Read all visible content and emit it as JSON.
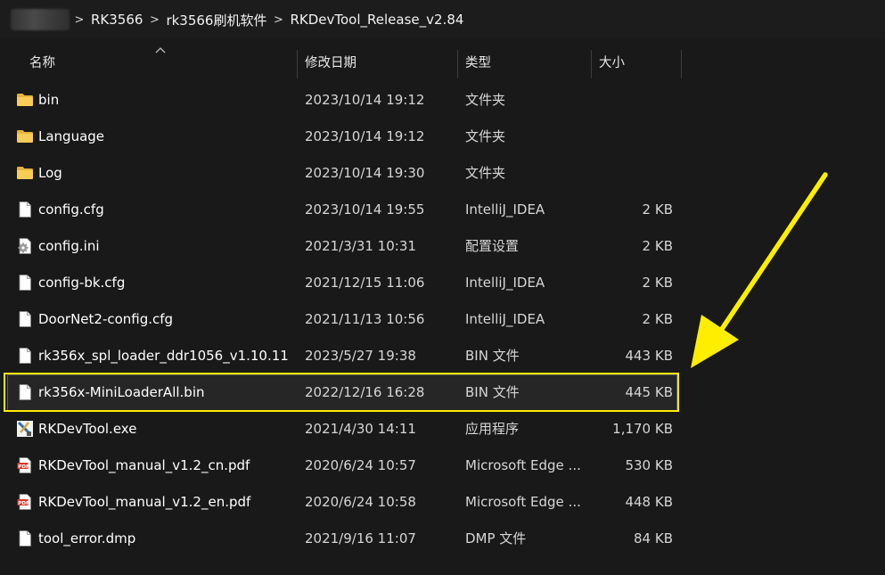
{
  "breadcrumb": {
    "items": [
      "RK3566",
      "rk3566刷机软件",
      "RKDevTool_Release_v2.84"
    ],
    "separator": ">"
  },
  "columns": {
    "name": "名称",
    "date": "修改日期",
    "type": "类型",
    "size": "大小"
  },
  "files": [
    {
      "name": "bin",
      "date": "2023/10/14 19:12",
      "type": "文件夹",
      "size": "",
      "icon": "folder-icon"
    },
    {
      "name": "Language",
      "date": "2023/10/14 19:12",
      "type": "文件夹",
      "size": "",
      "icon": "folder-icon"
    },
    {
      "name": "Log",
      "date": "2023/10/14 19:30",
      "type": "文件夹",
      "size": "",
      "icon": "folder-icon"
    },
    {
      "name": "config.cfg",
      "date": "2023/10/14 19:55",
      "type": "IntelliJ_IDEA",
      "size": "2 KB",
      "icon": "file-icon"
    },
    {
      "name": "config.ini",
      "date": "2021/3/31 10:31",
      "type": "配置设置",
      "size": "2 KB",
      "icon": "settings-file-icon"
    },
    {
      "name": "config-bk.cfg",
      "date": "2021/12/15 11:06",
      "type": "IntelliJ_IDEA",
      "size": "2 KB",
      "icon": "file-icon"
    },
    {
      "name": "DoorNet2-config.cfg",
      "date": "2021/11/13 10:56",
      "type": "IntelliJ_IDEA",
      "size": "2 KB",
      "icon": "file-icon"
    },
    {
      "name": "rk356x_spl_loader_ddr1056_v1.10.11...",
      "date": "2023/5/27 19:38",
      "type": "BIN 文件",
      "size": "443 KB",
      "icon": "file-icon"
    },
    {
      "name": "rk356x-MiniLoaderAll.bin",
      "date": "2022/12/16 16:28",
      "type": "BIN 文件",
      "size": "445 KB",
      "icon": "file-icon",
      "selected": true
    },
    {
      "name": "RKDevTool.exe",
      "date": "2021/4/30 14:11",
      "type": "应用程序",
      "size": "1,170 KB",
      "icon": "exe-icon"
    },
    {
      "name": "RKDevTool_manual_v1.2_cn.pdf",
      "date": "2020/6/24 10:57",
      "type": "Microsoft Edge ...",
      "size": "530 KB",
      "icon": "pdf-icon"
    },
    {
      "name": "RKDevTool_manual_v1.2_en.pdf",
      "date": "2020/6/24 10:58",
      "type": "Microsoft Edge ...",
      "size": "448 KB",
      "icon": "pdf-icon"
    },
    {
      "name": "tool_error.dmp",
      "date": "2021/9/16 11:07",
      "type": "DMP 文件",
      "size": "84 KB",
      "icon": "file-icon"
    }
  ],
  "colors": {
    "background": "#191919",
    "highlight": "#ffee00",
    "folder": "#f4c244",
    "pdf": "#d9382c"
  }
}
